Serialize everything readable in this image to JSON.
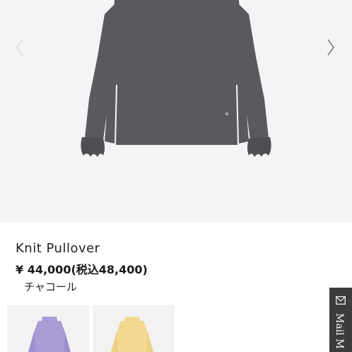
{
  "product": {
    "name": "Knit Pullover",
    "price": "¥ 44,000",
    "price_tax_included": "(税込48,400)",
    "color_name": "チャコール"
  },
  "gallery": {
    "prev_icon": "chevron-left-icon",
    "next_icon": "chevron-right-icon",
    "main_image_color": "#5a5b5e"
  },
  "color_swatches": [
    {
      "color": "#a99bd6"
    },
    {
      "color": "#f2d98f"
    }
  ],
  "mail_tab": {
    "label": "Mail M",
    "icon": "envelope-icon"
  }
}
